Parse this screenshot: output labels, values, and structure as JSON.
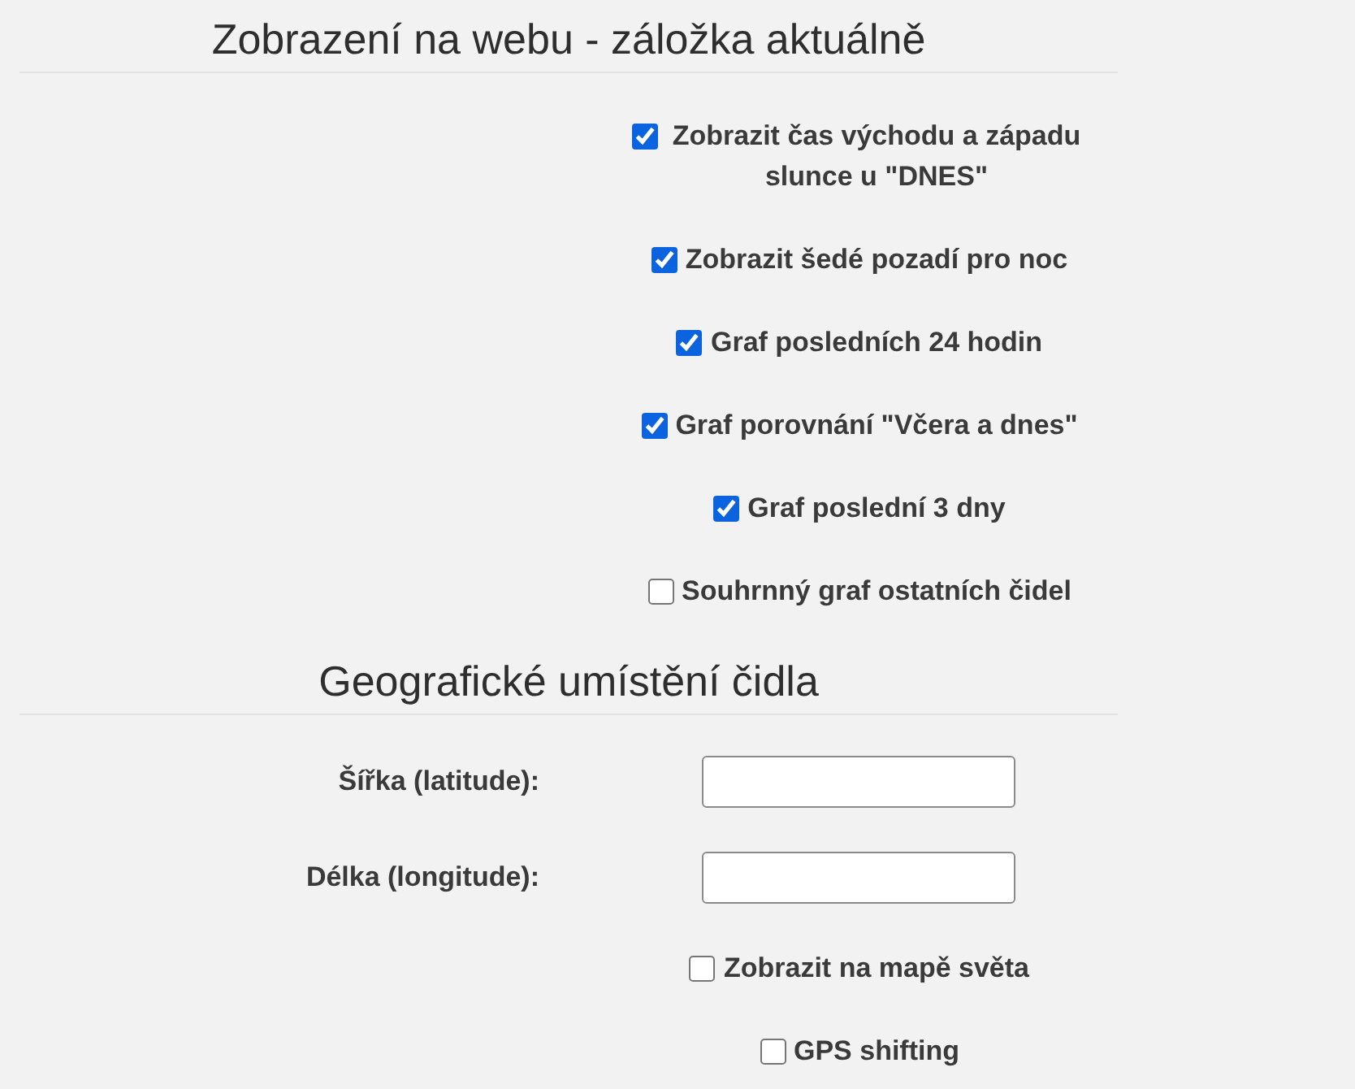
{
  "sections": [
    {
      "title": "Zobrazení na webu - záložka aktuálně",
      "items": [
        {
          "kind": "checkbox",
          "label": "Zobrazit čas východu a západu slunce u \"DNES\"",
          "checked": true
        },
        {
          "kind": "checkbox",
          "label": "Zobrazit šedé pozadí pro noc",
          "checked": true
        },
        {
          "kind": "checkbox",
          "label": "Graf posledních 24 hodin",
          "checked": true
        },
        {
          "kind": "checkbox",
          "label": "Graf porovnání \"Včera a dnes\"",
          "checked": true
        },
        {
          "kind": "checkbox",
          "label": "Graf poslední 3 dny",
          "checked": true
        },
        {
          "kind": "checkbox",
          "label": "Souhrnný graf ostatních čidel",
          "checked": false
        }
      ]
    },
    {
      "title": "Geografické umístění čidla",
      "items": [
        {
          "kind": "field",
          "label": "Šířka (latitude):"
        },
        {
          "kind": "field",
          "label": "Délka (longitude):"
        },
        {
          "kind": "checkbox",
          "label": "Zobrazit na mapě světa",
          "checked": false
        },
        {
          "kind": "checkbox",
          "label": "GPS shifting",
          "checked": false
        }
      ]
    }
  ]
}
